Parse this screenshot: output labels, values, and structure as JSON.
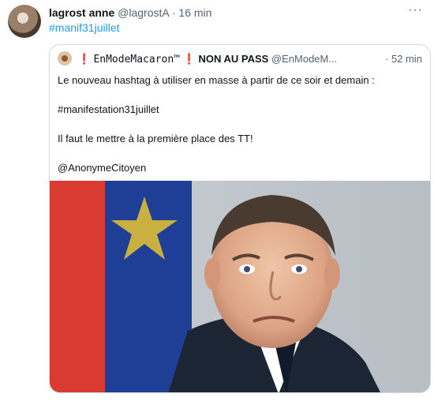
{
  "tweet": {
    "author_name": "lagrost anne",
    "handle": "@lagrostA",
    "separator": "·",
    "time": "16 min",
    "more_label": "···",
    "hashtag": "#manif31juillet"
  },
  "quote": {
    "excl_left": "❗",
    "author_name_mono": "EnModeMacaron™",
    "excl_right": "❗",
    "author_name_rest": "NON AU PASS",
    "handle": "@EnModeM...",
    "time": "· 52 min",
    "lines": [
      "Le nouveau hashtag à utiliser en masse à partir de ce soir et demain :",
      "#manifestation31juillet",
      "Il faut le mettre à la première place des TT!",
      "@AnonymeCitoyen"
    ]
  },
  "colors": {
    "link": "#1d9bf0",
    "muted": "#536471",
    "border": "#cfd9de",
    "alert": "#e0245e"
  }
}
